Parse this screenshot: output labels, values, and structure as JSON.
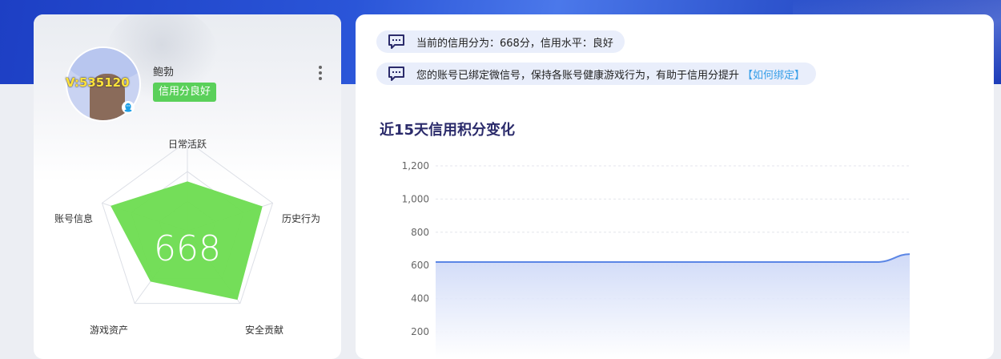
{
  "profile": {
    "vip_text": "V:535120",
    "user_name": "鲍勃",
    "status_badge": "信用分良好"
  },
  "radar": {
    "score": "668",
    "axes": [
      "日常活跃",
      "历史行为",
      "安全贡献",
      "游戏资产",
      "账号信息"
    ],
    "values": [
      0.55,
      0.88,
      0.95,
      0.7,
      0.9
    ],
    "fill_color": "#6ddc50"
  },
  "notices": [
    {
      "text": "当前的信用分为：668分，信用水平：良好",
      "link": ""
    },
    {
      "text": "您的账号已绑定微信号，保持各账号健康游戏行为，有助于信用分提升",
      "link": "【如何绑定】"
    }
  ],
  "chart_data": {
    "type": "area",
    "title": "近15天信用积分变化",
    "y_ticks": [
      "1,200",
      "1,000",
      "800",
      "600",
      "400",
      "200"
    ],
    "ylim": [
      200,
      1200
    ],
    "values": [
      620,
      620,
      620,
      620,
      620,
      620,
      620,
      620,
      620,
      620,
      620,
      620,
      620,
      620,
      668
    ],
    "grid": true,
    "line_color": "#5b86e5"
  }
}
